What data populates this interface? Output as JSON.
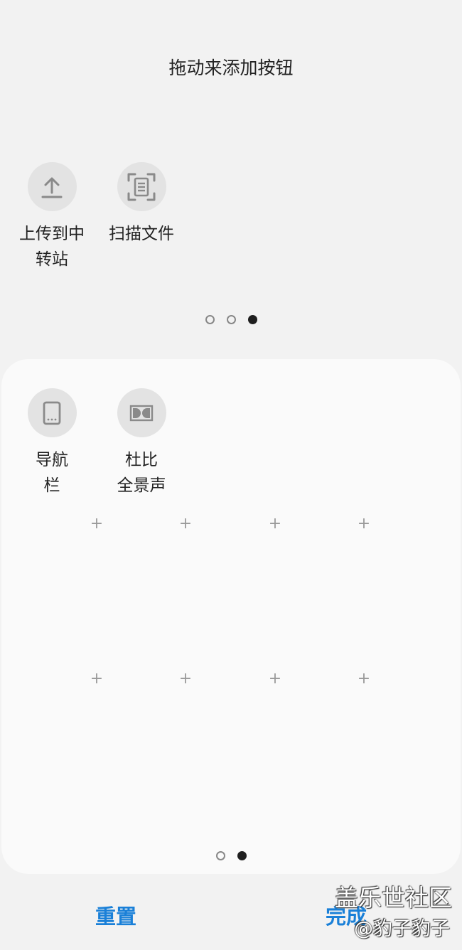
{
  "header": {
    "title": "拖动来添加按钮"
  },
  "available_buttons": [
    {
      "label_line1": "上传到中",
      "label_line2": "转站",
      "icon": "upload-icon"
    },
    {
      "label_line1": "扫描文件",
      "label_line2": "",
      "icon": "scan-document-icon"
    }
  ],
  "top_page_indicator": {
    "count": 3,
    "active_index": 2
  },
  "active_buttons": [
    {
      "label_line1": "导航",
      "label_line2": "栏",
      "icon": "navigation-bar-icon"
    },
    {
      "label_line1": "杜比",
      "label_line2": "全景声",
      "icon": "dolby-atmos-icon"
    }
  ],
  "panel_page_indicator": {
    "count": 2,
    "active_index": 1
  },
  "empty_slot_symbol": "+",
  "footer": {
    "reset_label": "重置",
    "done_label": "完成"
  },
  "watermark": {
    "line1": "盖乐世社区",
    "line2": "@豹子豹子"
  },
  "colors": {
    "accent": "#1a80d8",
    "background": "#f2f2f2",
    "panel": "#fafafa",
    "icon_circle": "#e3e3e3",
    "icon_stroke": "#8a8a8a"
  }
}
